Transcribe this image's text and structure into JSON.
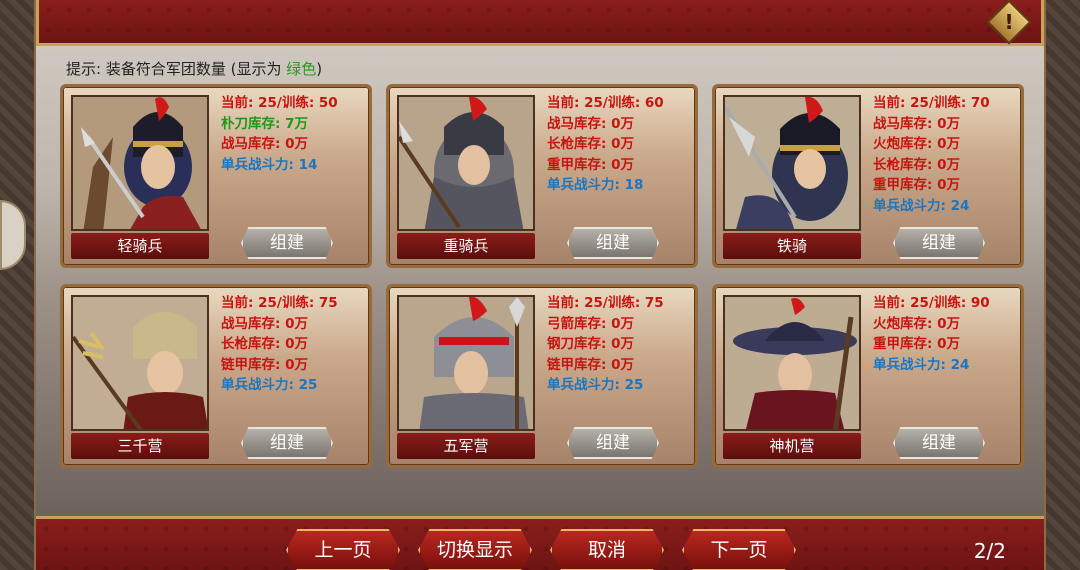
{
  "hint": {
    "prefix": "提示: 装备符合军团数量 (显示为 ",
    "green": "绿色",
    "suffix": ")"
  },
  "units": [
    {
      "name": "轻骑兵",
      "build": "组建",
      "stats": [
        {
          "text": "当前: 25/训练: 50",
          "color": "red"
        },
        {
          "text": "朴刀库存: 7万",
          "color": "green"
        },
        {
          "text": "战马库存: 0万",
          "color": "red"
        },
        {
          "text": "单兵战斗力: 14",
          "color": "blue"
        }
      ]
    },
    {
      "name": "重骑兵",
      "build": "组建",
      "stats": [
        {
          "text": "当前: 25/训练: 60",
          "color": "red"
        },
        {
          "text": "战马库存: 0万",
          "color": "red"
        },
        {
          "text": "长枪库存: 0万",
          "color": "red"
        },
        {
          "text": "重甲库存: 0万",
          "color": "red"
        },
        {
          "text": "单兵战斗力: 18",
          "color": "blue"
        }
      ]
    },
    {
      "name": "铁骑",
      "build": "组建",
      "stats": [
        {
          "text": "当前: 25/训练: 70",
          "color": "red"
        },
        {
          "text": "战马库存: 0万",
          "color": "red"
        },
        {
          "text": "火炮库存: 0万",
          "color": "red"
        },
        {
          "text": "长枪库存: 0万",
          "color": "red"
        },
        {
          "text": "重甲库存: 0万",
          "color": "red"
        },
        {
          "text": "单兵战斗力: 24",
          "color": "blue"
        }
      ]
    },
    {
      "name": "三千营",
      "build": "组建",
      "stats": [
        {
          "text": "当前: 25/训练: 75",
          "color": "red"
        },
        {
          "text": "战马库存: 0万",
          "color": "red"
        },
        {
          "text": "长枪库存: 0万",
          "color": "red"
        },
        {
          "text": "链甲库存: 0万",
          "color": "red"
        },
        {
          "text": "单兵战斗力: 25",
          "color": "blue"
        }
      ]
    },
    {
      "name": "五军营",
      "build": "组建",
      "stats": [
        {
          "text": "当前: 25/训练: 75",
          "color": "red"
        },
        {
          "text": "弓箭库存: 0万",
          "color": "red"
        },
        {
          "text": "钢刀库存: 0万",
          "color": "red"
        },
        {
          "text": "链甲库存: 0万",
          "color": "red"
        },
        {
          "text": "单兵战斗力: 25",
          "color": "blue"
        }
      ]
    },
    {
      "name": "神机营",
      "build": "组建",
      "stats": [
        {
          "text": "当前: 25/训练: 90",
          "color": "red"
        },
        {
          "text": "火炮库存: 0万",
          "color": "red"
        },
        {
          "text": "重甲库存: 0万",
          "color": "red"
        },
        {
          "text": "单兵战斗力: 24",
          "color": "blue"
        }
      ]
    }
  ],
  "nav": {
    "prev": "上一页",
    "toggle": "切换显示",
    "cancel": "取消",
    "next": "下一页"
  },
  "page": "2/2",
  "alert_icon": "!",
  "colors": {
    "red": "#c8140f",
    "green": "#1a9a18",
    "blue": "#1976c2"
  }
}
